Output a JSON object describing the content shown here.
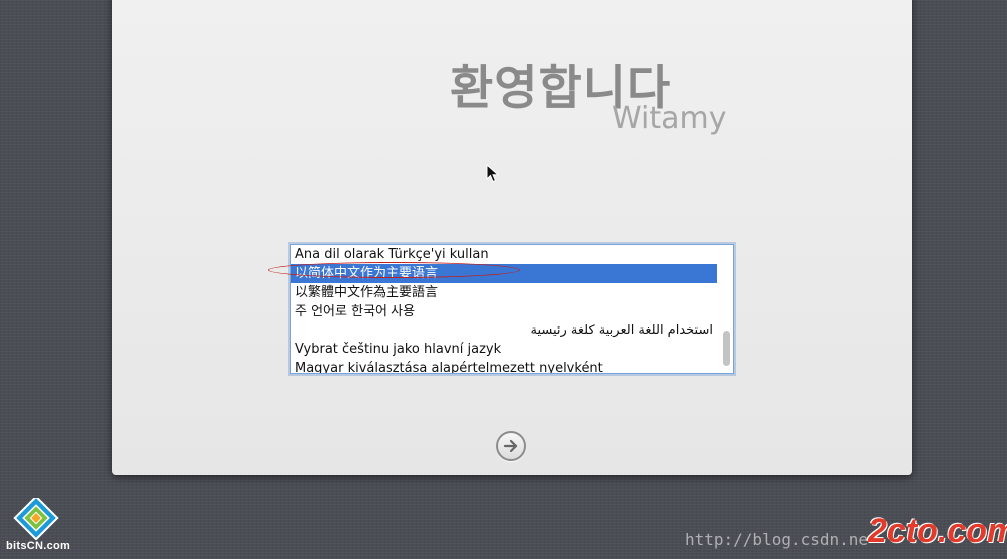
{
  "welcome": {
    "title": "환영합니다",
    "subtitle": "Witamy"
  },
  "language_list": {
    "items": [
      "Ana dil olarak Türkçe'yi kullan",
      "以简体中文作为主要语言",
      "以繁體中文作為主要語言",
      "주 언어로 한국어 사용",
      "استخدام اللغة العربية كلغة رئيسية",
      "Vybrat češtinu jako hlavní jazyk",
      "Magyar kiválasztása alapértelmezett nyelvként"
    ],
    "selected_index": 1
  },
  "next_button": {
    "icon": "arrow-right-icon"
  },
  "watermarks": {
    "logo_text": "bitsCN.com",
    "url": "http://blog.csdn.ne",
    "brand": "2cto.com"
  },
  "colors": {
    "selection": "#3a76d4",
    "annotation_red": "#c02020",
    "background": "#4a4d54"
  }
}
